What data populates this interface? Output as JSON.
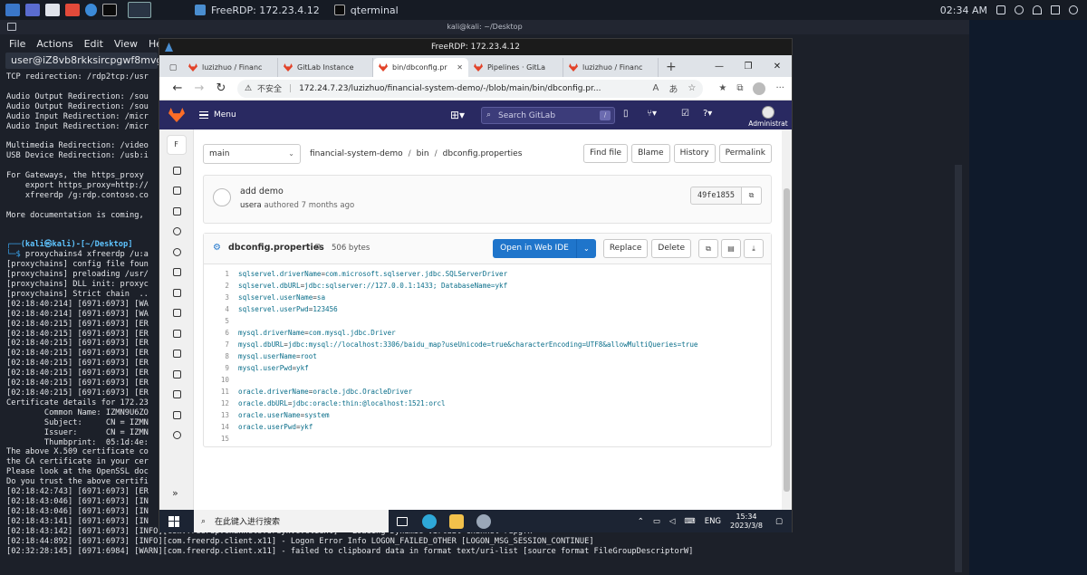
{
  "kali_panel": {
    "tasks": [
      "FreeRDP: 172.23.4.12",
      "qterminal"
    ],
    "qterminal_count": "3",
    "time": "02:34 AM"
  },
  "terminal": {
    "title": "kali@kali: ~/Desktop",
    "menu": [
      "File",
      "Actions",
      "Edit",
      "View",
      "Help"
    ],
    "tab_label": "user@iZ8vb8rkksircpgwf8mvgtZ:",
    "lines": [
      "TCP redirection: /rdp2tcp:/usr",
      "",
      "Audio Output Redirection: /sou",
      "Audio Output Redirection: /sou",
      "Audio Input Redirection: /micr",
      "Audio Input Redirection: /micr",
      "",
      "Multimedia Redirection: /video",
      "USB Device Redirection: /usb:i",
      "",
      "For Gateways, the https_proxy",
      "    export https_proxy=http://",
      "    xfreerdp /g:rdp.contoso.co",
      "",
      "More documentation is coming,",
      "",
      ""
    ],
    "prompt_user": "(kali㉿kali)-[~/Desktop]",
    "prompt_cmd": "proxychains4 xfreerdp /u:a",
    "log_lines": [
      "[proxychains] config file foun",
      "[proxychains] preloading /usr/",
      "[proxychains] DLL init: proxyc",
      "[proxychains] Strict chain  ..",
      "[02:18:40:214] [6971:6973] [WA",
      "[02:18:40:214] [6971:6973] [WA",
      "[02:18:40:215] [6971:6973] [ER",
      "[02:18:40:215] [6971:6973] [ER",
      "[02:18:40:215] [6971:6973] [ER",
      "[02:18:40:215] [6971:6973] [ER",
      "[02:18:40:215] [6971:6973] [ER",
      "[02:18:40:215] [6971:6973] [ER",
      "[02:18:40:215] [6971:6973] [ER",
      "[02:18:40:215] [6971:6973] [ER",
      "Certificate details for 172.23",
      "        Common Name: IZMN9U6ZO",
      "        Subject:     CN = IZMN",
      "        Issuer:      CN = IZMN",
      "        Thumbprint:  05:1d:4e:",
      "The above X.509 certificate co",
      "the CA certificate in your cer",
      "Please look at the OpenSSL doc",
      "Do you trust the above certifi",
      "[02:18:42:743] [6971:6973] [ER",
      "[02:18:43:046] [6971:6973] [IN",
      "[02:18:43:046] [6971:6973] [IN",
      "[02:18:43:141] [6971:6973] [IN",
      "[02:18:43:142] [6971:6973] [INFO][com.freerdp.channels.drdynvc.client] - Loading Dynamic Virtual Channel rdpgfx",
      "[02:18:44:892] [6971:6973] [INFO][com.freerdp.client.x11] - Logon Error Info LOGON_FAILED_OTHER [LOGON_MSG_SESSION_CONTINUE]",
      "[02:32:28:145] [6971:6984] [WARN][com.freerdp.client.x11] - failed to clipboard data in format text/uri-list [source format FileGroupDescriptorW]"
    ]
  },
  "rdp": {
    "title": "FreeRDP: 172.23.4.12"
  },
  "edge": {
    "tabs": [
      {
        "label": "luzizhuo / Financ"
      },
      {
        "label": "GitLab Instance"
      },
      {
        "label": "bin/dbconfig.pr"
      },
      {
        "label": "Pipelines · GitLa"
      },
      {
        "label": "luzizhuo / Financ"
      }
    ],
    "security_label": "不安全",
    "url": "172.24.7.23/luzizhuo/financial-system-demo/-/blob/main/bin/dbconfig.pr..."
  },
  "gitlab": {
    "menu_label": "Menu",
    "search_placeholder": "Search GitLab",
    "search_key": "/",
    "admin_label": "Administrat",
    "sidebar_project_letter": "F",
    "branch": "main",
    "breadcrumb": [
      "financial-system-demo",
      "bin",
      "dbconfig.properties"
    ],
    "file_buttons": [
      "Find file",
      "Blame",
      "History",
      "Permalink"
    ],
    "commit": {
      "title": "add demo",
      "author": "usera",
      "authored_text": "authored",
      "time": "7 months ago",
      "sha": "49fe1855"
    },
    "file": {
      "name": "dbconfig.properties",
      "size": "506 bytes",
      "open_ide": "Open in Web IDE",
      "replace": "Replace",
      "delete": "Delete"
    },
    "code_lines": [
      {
        "n": "1",
        "k": "sqlservel.driverName",
        "v": "com.microsoft.sqlserver.jdbc.SQLServerDriver"
      },
      {
        "n": "2",
        "k": "sqlservel.dbURL",
        "v": "jdbc:sqlserver://127.0.0.1:1433; DatabaseName=ykf"
      },
      {
        "n": "3",
        "k": "sqlservel.userName",
        "v": "sa"
      },
      {
        "n": "4",
        "k": "sqlservel.userPwd",
        "v": "123456"
      },
      {
        "n": "5",
        "k": "",
        "v": ""
      },
      {
        "n": "6",
        "k": "mysql.driverName",
        "v": "com.mysql.jdbc.Driver"
      },
      {
        "n": "7",
        "k": "mysql.dbURL",
        "v": "jdbc:mysql://localhost:3306/baidu_map?useUnicode=true&characterEncoding=UTF8&allowMultiQueries=true"
      },
      {
        "n": "8",
        "k": "mysql.userName",
        "v": "root"
      },
      {
        "n": "9",
        "k": "mysql.userPwd",
        "v": "ykf"
      },
      {
        "n": "10",
        "k": "",
        "v": ""
      },
      {
        "n": "11",
        "k": "oracle.driverName",
        "v": "oracle.jdbc.OracleDriver"
      },
      {
        "n": "12",
        "k": "oracle.dbURL",
        "v": "jdbc:oracle:thin:@localhost:1521:orcl"
      },
      {
        "n": "13",
        "k": "oracle.userName",
        "v": "system"
      },
      {
        "n": "14",
        "k": "oracle.userPwd",
        "v": "ykf"
      },
      {
        "n": "15",
        "k": "",
        "v": ""
      }
    ]
  },
  "windows_taskbar": {
    "search_placeholder": "在此键入进行搜索",
    "lang": "ENG",
    "time": "15:34",
    "date": "2023/3/8"
  },
  "colors": {
    "gitlab_header": "#292961",
    "gitlab_primary": "#1f75cb",
    "terminal_bg": "#1c2029"
  }
}
